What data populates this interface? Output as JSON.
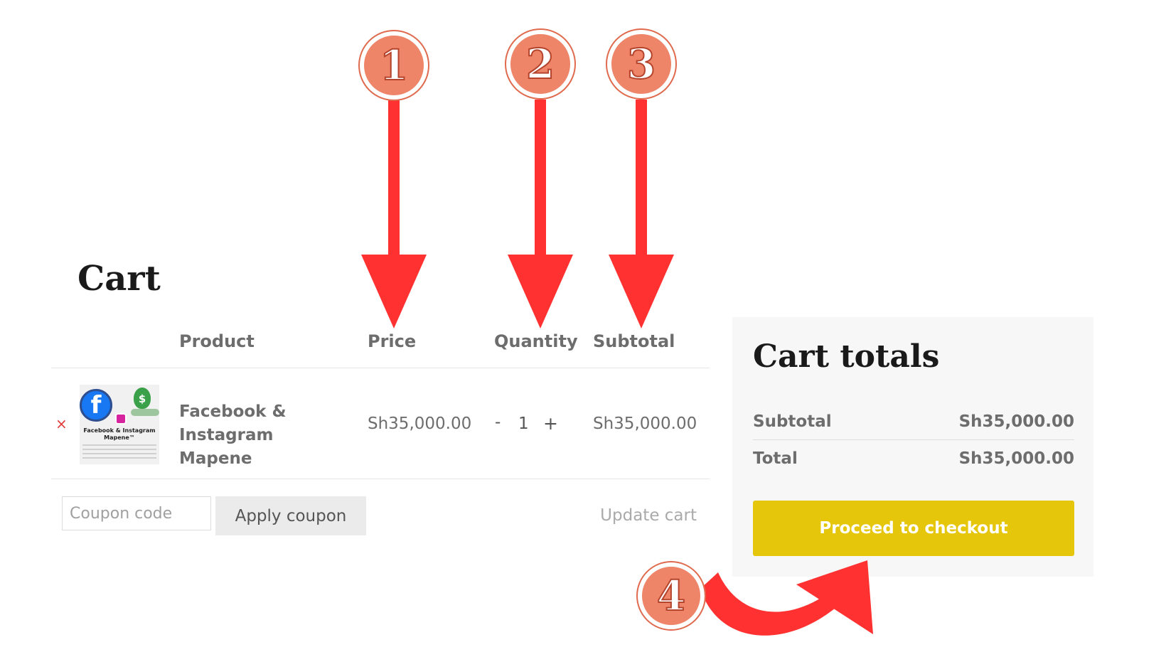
{
  "cart": {
    "title": "Cart",
    "columns": {
      "product": "Product",
      "price": "Price",
      "quantity": "Quantity",
      "subtotal": "Subtotal"
    },
    "items": [
      {
        "remove_icon": "close-icon",
        "remove_glyph": "×",
        "name": "Facebook & Instagram Mapene",
        "thumbnail_caption": "Facebook & Instagram Mapene™",
        "price": "Sh35,000.00",
        "quantity": "1",
        "minus_label": "-",
        "plus_label": "+",
        "subtotal": "Sh35,000.00"
      }
    ],
    "coupon": {
      "placeholder": "Coupon code",
      "value": "",
      "apply_label": "Apply coupon"
    },
    "update_label": "Update cart"
  },
  "cart_totals": {
    "title": "Cart totals",
    "subtotal_label": "Subtotal",
    "subtotal_value": "Sh35,000.00",
    "total_label": "Total",
    "total_value": "Sh35,000.00",
    "checkout_label": "Proceed to checkout"
  },
  "annotations": {
    "markers": [
      "1",
      "2",
      "3",
      "4"
    ],
    "arrow_color": "#ff3131",
    "marker_fill": "#ee8468",
    "marker_ring": "#ffffff"
  },
  "colors": {
    "checkout_button": "#e6c60a",
    "remove_icon": "#e03a3a",
    "panel_background": "#f7f7f7"
  }
}
